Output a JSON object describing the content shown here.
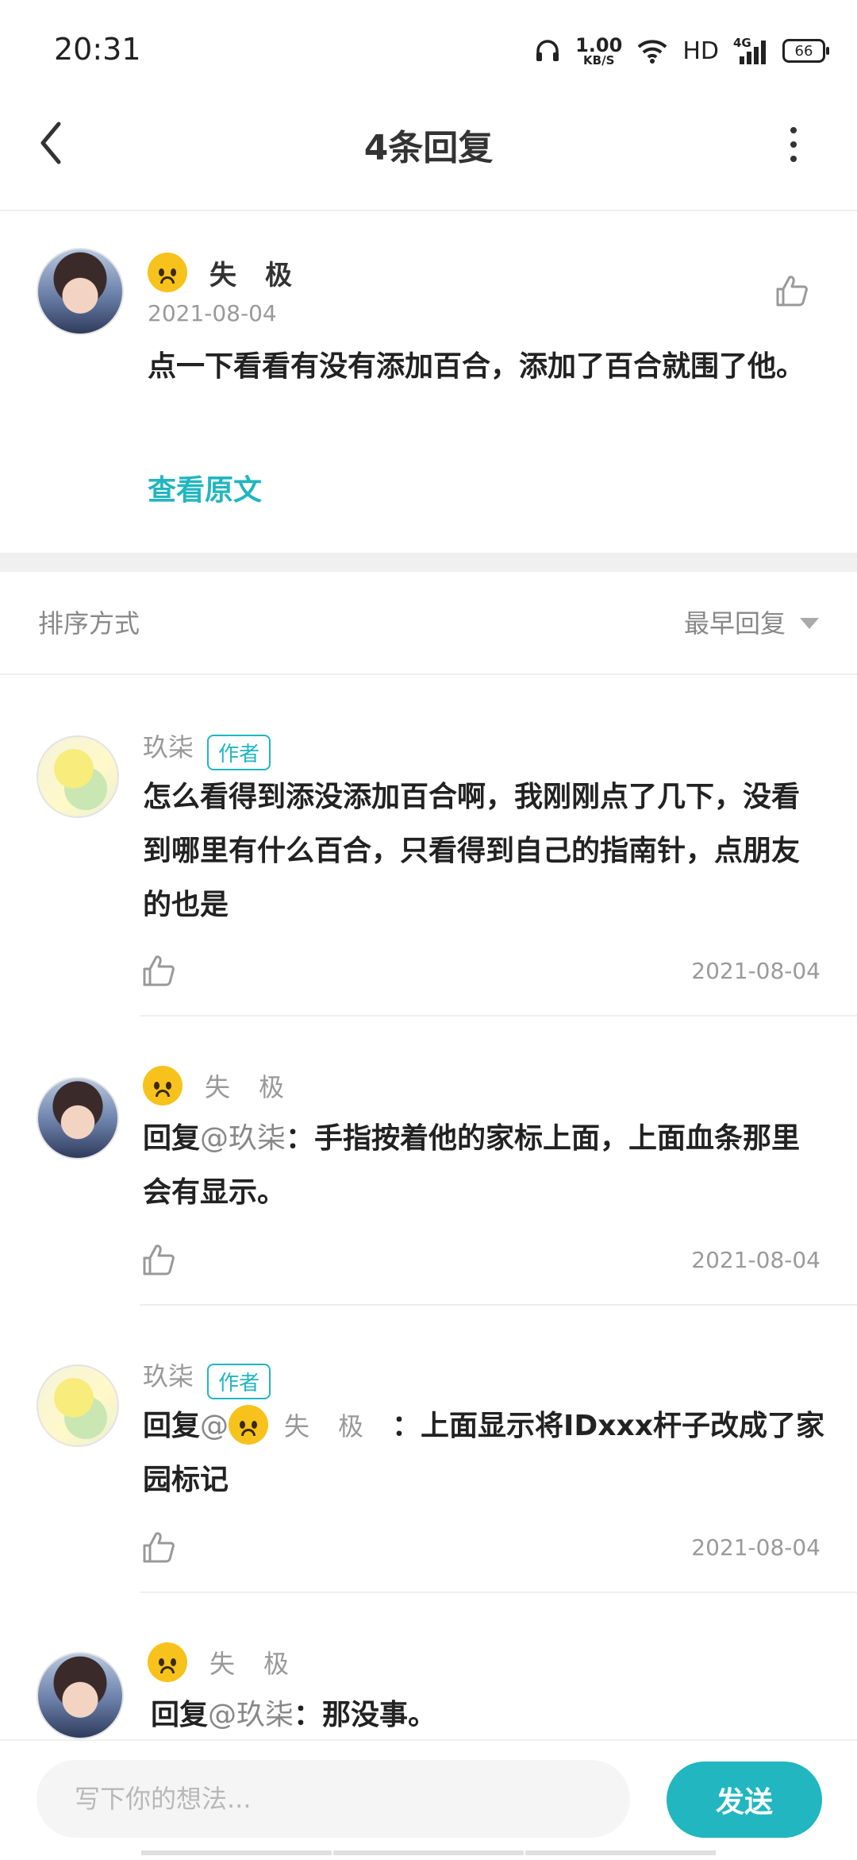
{
  "status_bar": {
    "time": "20:31",
    "speed_value": "1.00",
    "speed_unit": "KB/S",
    "network": "HD",
    "signal_label": "4G",
    "battery": "66"
  },
  "header": {
    "title": "4条回复"
  },
  "original": {
    "author": "失极",
    "date": "2021-08-04",
    "text": "点一下看看有没有添加百合，添加了百合就围了他。",
    "view_original": "查看原文"
  },
  "sort": {
    "label": "排序方式",
    "value": "最早回复"
  },
  "replies": [
    {
      "author": "玖柒",
      "badge": "作者",
      "text": "怎么看得到添没添加百合啊，我刚刚点了几下，没看到哪里有什么百合，只看得到自己的指南针，点朋友的也是",
      "date": "2021-08-04"
    },
    {
      "author": "失极",
      "prefix": "回复",
      "mention": "@玖柒",
      "text": "：手指按着他的家标上面，上面血条那里会有显示。",
      "date": "2021-08-04"
    },
    {
      "author": "玖柒",
      "badge": "作者",
      "prefix": "回复",
      "mention": "@",
      "mention_name": "失极",
      "text": "：上面显示将IDxxx杆子改成了家园标记",
      "date": "2021-08-04"
    },
    {
      "author": "失极",
      "prefix": "回复",
      "mention": "@玖柒",
      "text": "：那没事。"
    }
  ],
  "composer": {
    "placeholder": "写下你的想法...",
    "send_label": "发送"
  },
  "colors": {
    "accent": "#21b6c0"
  }
}
